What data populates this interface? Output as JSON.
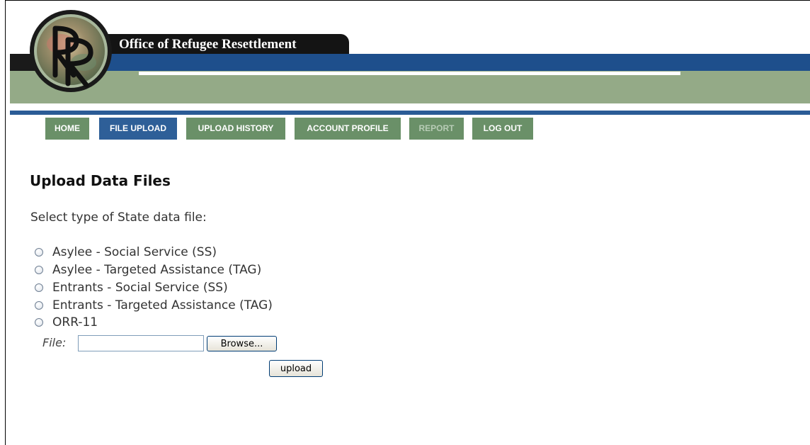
{
  "header": {
    "title": "Office of Refugee Resettlement",
    "logo_letters": "RR"
  },
  "nav": {
    "items": [
      {
        "label": "HOME",
        "active": false
      },
      {
        "label": "FILE UPLOAD",
        "active": true
      },
      {
        "label": "UPLOAD HISTORY",
        "active": false
      },
      {
        "label": "ACCOUNT PROFILE",
        "active": false
      },
      {
        "label": "REPORT",
        "active": false
      },
      {
        "label": "LOG OUT",
        "active": false
      }
    ]
  },
  "main": {
    "title": "Upload Data Files",
    "prompt": "Select type of State data file:",
    "options": [
      {
        "label": "Asylee - Social Service (SS)",
        "selected": false
      },
      {
        "label": "Asylee - Targeted Assistance (TAG)",
        "selected": false
      },
      {
        "label": "Entrants - Social Service (SS)",
        "selected": false
      },
      {
        "label": "Entrants - Targeted Assistance (TAG)",
        "selected": false
      },
      {
        "label": "ORR-11",
        "selected": false
      }
    ],
    "file_label": "File:",
    "file_value": "",
    "browse_label": "Browse...",
    "upload_label": "upload"
  },
  "colors": {
    "header_blue": "#1e4f8c",
    "header_green": "#94aa87",
    "nav_green": "#6a9068",
    "nav_active_blue": "#2e5f98"
  }
}
